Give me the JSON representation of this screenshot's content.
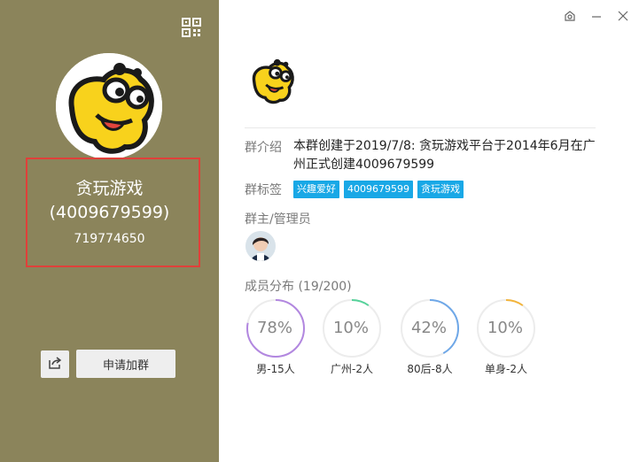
{
  "profile": {
    "name": "贪玩游戏",
    "id_display": "(4009679599)",
    "number": "719774650"
  },
  "actions": {
    "join_label": "申请加群"
  },
  "window": {
    "controls": [
      "skin-icon",
      "minimize-icon",
      "close-icon"
    ]
  },
  "info": {
    "intro_label": "群介绍",
    "intro_text": "本群创建于2019/7/8: 贪玩游戏平台于2014年6月在广州正式创建4009679599",
    "tags_label": "群标签",
    "tags": [
      "兴趣爱好",
      "4009679599",
      "贪玩游戏"
    ],
    "admins_label": "群主/管理员"
  },
  "members": {
    "label": "成员分布 (19/200)",
    "stats": [
      {
        "pct": "78%",
        "value": 0.78,
        "caption": "男-15人",
        "color": "#b287e0"
      },
      {
        "pct": "10%",
        "value": 0.1,
        "caption": "广州-2人",
        "color": "#55d29a"
      },
      {
        "pct": "42%",
        "value": 0.42,
        "caption": "80后-8人",
        "color": "#6fa8e8"
      },
      {
        "pct": "10%",
        "value": 0.1,
        "caption": "单身-2人",
        "color": "#f3b43a"
      }
    ]
  },
  "colors": {
    "left_panel": "#8b845b",
    "tag": "#19a8e6",
    "highlight_border": "#e0403a"
  }
}
